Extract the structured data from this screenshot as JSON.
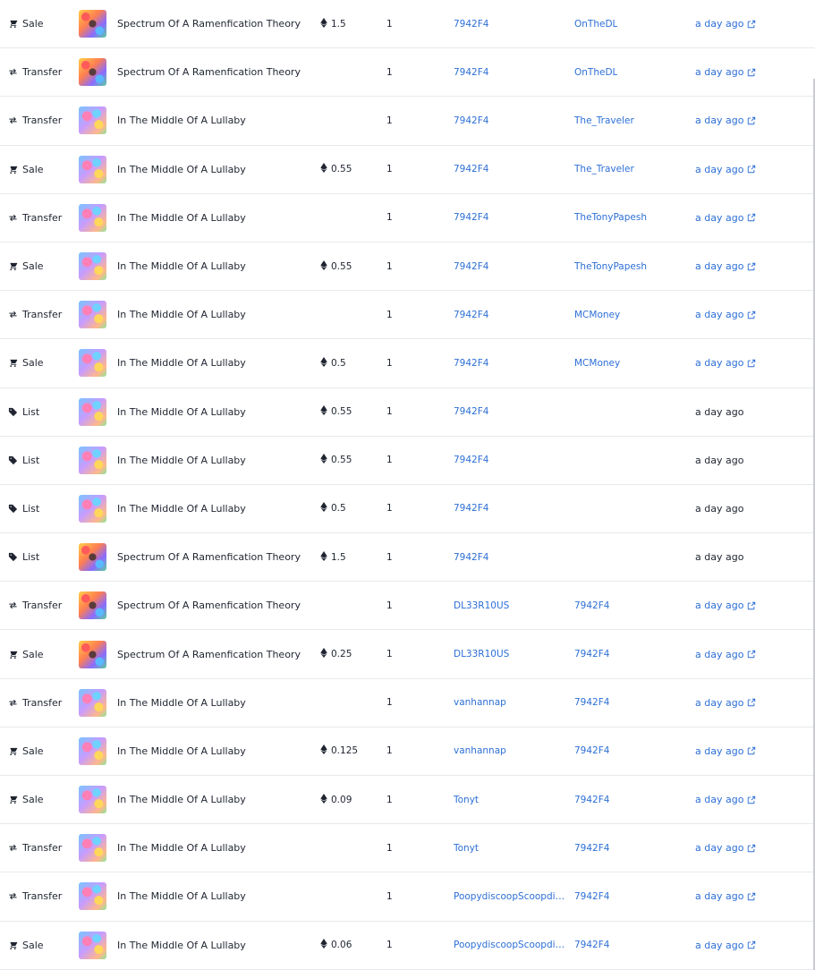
{
  "rows": [
    {
      "event": "Sale",
      "event_icon": "cart-icon",
      "item": "Spectrum Of A Ramenfication Theory",
      "thumb": "spectrum",
      "price": "1.5",
      "qty": "1",
      "from": "7942F4",
      "to": "OnTheDL",
      "time": "a day ago",
      "time_link": true
    },
    {
      "event": "Transfer",
      "event_icon": "transfer-arrows-icon",
      "item": "Spectrum Of A Ramenfication Theory",
      "thumb": "spectrum",
      "price": "",
      "qty": "1",
      "from": "7942F4",
      "to": "OnTheDL",
      "time": "a day ago",
      "time_link": true
    },
    {
      "event": "Transfer",
      "event_icon": "transfer-arrows-icon",
      "item": "In The Middle Of A Lullaby",
      "thumb": "lullaby",
      "price": "",
      "qty": "1",
      "from": "7942F4",
      "to": "The_Traveler",
      "time": "a day ago",
      "time_link": true
    },
    {
      "event": "Sale",
      "event_icon": "cart-icon",
      "item": "In The Middle Of A Lullaby",
      "thumb": "lullaby",
      "price": "0.55",
      "qty": "1",
      "from": "7942F4",
      "to": "The_Traveler",
      "time": "a day ago",
      "time_link": true
    },
    {
      "event": "Transfer",
      "event_icon": "transfer-arrows-icon",
      "item": "In The Middle Of A Lullaby",
      "thumb": "lullaby",
      "price": "",
      "qty": "1",
      "from": "7942F4",
      "to": "TheTonyPapesh",
      "time": "a day ago",
      "time_link": true
    },
    {
      "event": "Sale",
      "event_icon": "cart-icon",
      "item": "In The Middle Of A Lullaby",
      "thumb": "lullaby",
      "price": "0.55",
      "qty": "1",
      "from": "7942F4",
      "to": "TheTonyPapesh",
      "time": "a day ago",
      "time_link": true
    },
    {
      "event": "Transfer",
      "event_icon": "transfer-arrows-icon",
      "item": "In The Middle Of A Lullaby",
      "thumb": "lullaby",
      "price": "",
      "qty": "1",
      "from": "7942F4",
      "to": "MCMoney",
      "time": "a day ago",
      "time_link": true
    },
    {
      "event": "Sale",
      "event_icon": "cart-icon",
      "item": "In The Middle Of A Lullaby",
      "thumb": "lullaby",
      "price": "0.5",
      "qty": "1",
      "from": "7942F4",
      "to": "MCMoney",
      "time": "a day ago",
      "time_link": true
    },
    {
      "event": "List",
      "event_icon": "tag-icon",
      "item": "In The Middle Of A Lullaby",
      "thumb": "lullaby",
      "price": "0.55",
      "qty": "1",
      "from": "7942F4",
      "to": "",
      "time": "a day ago",
      "time_link": false
    },
    {
      "event": "List",
      "event_icon": "tag-icon",
      "item": "In The Middle Of A Lullaby",
      "thumb": "lullaby",
      "price": "0.55",
      "qty": "1",
      "from": "7942F4",
      "to": "",
      "time": "a day ago",
      "time_link": false
    },
    {
      "event": "List",
      "event_icon": "tag-icon",
      "item": "In The Middle Of A Lullaby",
      "thumb": "lullaby",
      "price": "0.5",
      "qty": "1",
      "from": "7942F4",
      "to": "",
      "time": "a day ago",
      "time_link": false
    },
    {
      "event": "List",
      "event_icon": "tag-icon",
      "item": "Spectrum Of A Ramenfication Theory",
      "thumb": "spectrum",
      "price": "1.5",
      "qty": "1",
      "from": "7942F4",
      "to": "",
      "time": "a day ago",
      "time_link": false
    },
    {
      "event": "Transfer",
      "event_icon": "transfer-arrows-icon",
      "item": "Spectrum Of A Ramenfication Theory",
      "thumb": "spectrum",
      "price": "",
      "qty": "1",
      "from": "DL33R10US",
      "to": "7942F4",
      "time": "a day ago",
      "time_link": true
    },
    {
      "event": "Sale",
      "event_icon": "cart-icon",
      "item": "Spectrum Of A Ramenfication Theory",
      "thumb": "spectrum",
      "price": "0.25",
      "qty": "1",
      "from": "DL33R10US",
      "to": "7942F4",
      "time": "a day ago",
      "time_link": true
    },
    {
      "event": "Transfer",
      "event_icon": "transfer-arrows-icon",
      "item": "In The Middle Of A Lullaby",
      "thumb": "lullaby",
      "price": "",
      "qty": "1",
      "from": "vanhannap",
      "to": "7942F4",
      "time": "a day ago",
      "time_link": true
    },
    {
      "event": "Sale",
      "event_icon": "cart-icon",
      "item": "In The Middle Of A Lullaby",
      "thumb": "lullaby",
      "price": "0.125",
      "qty": "1",
      "from": "vanhannap",
      "to": "7942F4",
      "time": "a day ago",
      "time_link": true
    },
    {
      "event": "Sale",
      "event_icon": "cart-icon",
      "item": "In The Middle Of A Lullaby",
      "thumb": "lullaby",
      "price": "0.09",
      "qty": "1",
      "from": "Tonyt",
      "to": "7942F4",
      "time": "a day ago",
      "time_link": true
    },
    {
      "event": "Transfer",
      "event_icon": "transfer-arrows-icon",
      "item": "In The Middle Of A Lullaby",
      "thumb": "lullaby",
      "price": "",
      "qty": "1",
      "from": "Tonyt",
      "to": "7942F4",
      "time": "a day ago",
      "time_link": true
    },
    {
      "event": "Transfer",
      "event_icon": "transfer-arrows-icon",
      "item": "In The Middle Of A Lullaby",
      "thumb": "lullaby",
      "price": "",
      "qty": "1",
      "from": "PoopydiscoopScoopdid...",
      "to": "7942F4",
      "time": "a day ago",
      "time_link": true
    },
    {
      "event": "Sale",
      "event_icon": "cart-icon",
      "item": "In The Middle Of A Lullaby",
      "thumb": "lullaby",
      "price": "0.06",
      "qty": "1",
      "from": "PoopydiscoopScoopdid...",
      "to": "7942F4",
      "time": "a day ago",
      "time_link": true
    }
  ],
  "colors": {
    "link": "#2d6fd6",
    "text": "#1f2430",
    "divider": "#e7e9ee"
  },
  "currency_icon": "ethereum-icon"
}
